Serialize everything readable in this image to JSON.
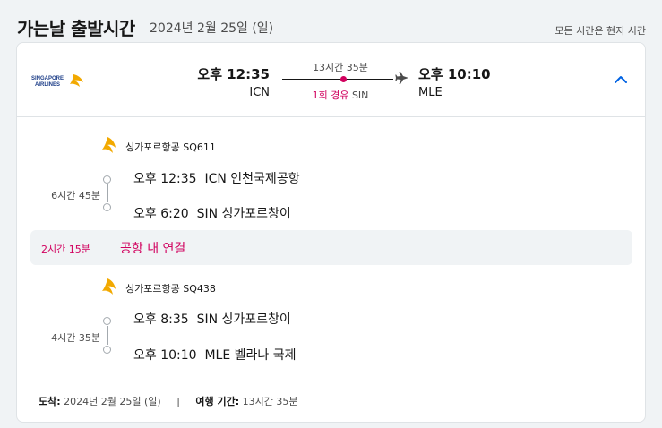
{
  "header": {
    "title": "가는날 출발시간",
    "date": "2024년 2월 25일 (일)",
    "timezone_note": "모든 시간은 현지 시간"
  },
  "summary": {
    "airline_logo": "singapore-airlines-logo",
    "dep_time": "오후 12:35",
    "dep_code": "ICN",
    "duration": "13시간 35분",
    "stops_label": "1회 경유",
    "stop_code": "SIN",
    "arr_time": "오후 10:10",
    "arr_code": "MLE"
  },
  "segments": [
    {
      "airline": "싱가포르항공 SQ611",
      "duration": "6시간 45분",
      "dep_time": "오후 12:35",
      "dep_place": "ICN 인천국제공항",
      "arr_time": "오후 6:20",
      "arr_place": "SIN 싱가포르창이"
    },
    {
      "airline": "싱가포르항공 SQ438",
      "duration": "4시간 35분",
      "dep_time": "오후 8:35",
      "dep_place": "SIN 싱가포르창이",
      "arr_time": "오후 10:10",
      "arr_place": "MLE 벨라나 국제"
    }
  ],
  "layover": {
    "duration": "2시간 15분",
    "text": "공항 내 연결"
  },
  "footer": {
    "arrival_label": "도착:",
    "arrival_value": "2024년 2월 25일 (일)",
    "separator": "|",
    "trip_label": "여행 기간:",
    "trip_value": "13시간 35분"
  },
  "colors": {
    "accent_red": "#d1005e",
    "link_blue": "#0062e3",
    "text": "#161616"
  }
}
